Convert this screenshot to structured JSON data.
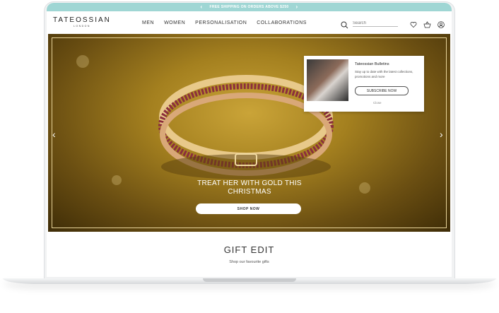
{
  "promo_bar": {
    "text": "FREE SHIPPING ON ORDERS ABOVE $250",
    "prev_icon": "chevron-left-icon",
    "next_icon": "chevron-right-icon"
  },
  "header": {
    "logo_main": "TATEOSSIAN",
    "logo_sub": "LONDON",
    "menu": [
      "MEN",
      "WOMEN",
      "PERSONALISATION",
      "COLLABORATIONS"
    ],
    "search_placeholder": "Search",
    "icons": [
      "heart-icon",
      "basket-icon",
      "account-icon"
    ]
  },
  "hero": {
    "title": "TREAT HER WITH GOLD THIS CHRISTMAS",
    "button": "SHOP NOW"
  },
  "popup": {
    "title": "Tateossian Bulletins",
    "text": "Stay up to date with the latest collections, promotions and more",
    "button": "SUBSCRIBE NOW",
    "close": "Close"
  },
  "section": {
    "title": "GIFT EDIT",
    "subtitle": "Shop our favourite gifts"
  },
  "colors": {
    "promo": "#9fd6d4",
    "hero_gold": "#a4801f"
  }
}
